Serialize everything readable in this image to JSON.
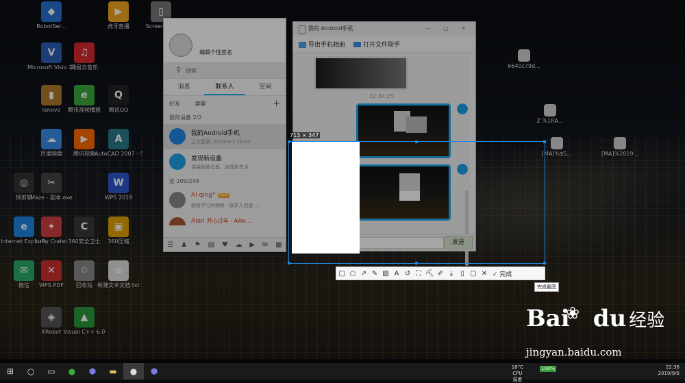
{
  "desktop": {
    "icons": [
      {
        "label": "RobotSer...",
        "glyph": "◆",
        "color": "#2a6fd0"
      },
      {
        "label": "虎牙直播",
        "glyph": "▶",
        "color": "#f5a623"
      },
      {
        "label": "Screenshot",
        "glyph": "▯",
        "color": "#777777"
      },
      {
        "label": "Microsoft Visio 2010",
        "glyph": "V",
        "color": "#2b5fb4"
      },
      {
        "label": "网易云音乐",
        "glyph": "♫",
        "color": "#d7282f"
      },
      {
        "label": "lenovo",
        "glyph": "▮",
        "color": "#b07a2a"
      },
      {
        "label": "腾讯视频播放",
        "glyph": "e",
        "color": "#3caa3c"
      },
      {
        "label": "腾讯QQ",
        "glyph": "Q",
        "color": "#222222"
      },
      {
        "label": "百度网盘",
        "glyph": "☁",
        "color": "#3a8ee6"
      },
      {
        "label": "腾讯视频",
        "glyph": "▶",
        "color": "#ff6a00"
      },
      {
        "label": "AutoCAD 2007 - S...",
        "glyph": "A",
        "color": "#2a7a8a"
      },
      {
        "label": "快剪辑",
        "glyph": "◎",
        "color": "#333333"
      },
      {
        "label": "Maze - 副本.exe",
        "glyph": "✂",
        "color": "#444444"
      },
      {
        "label": "WPS 2019",
        "glyph": "W",
        "color": "#2a58d0"
      },
      {
        "label": "Internet Explorer",
        "glyph": "e",
        "color": "#1e88e5"
      },
      {
        "label": "LuBy Crater",
        "glyph": "✦",
        "color": "#d04040"
      },
      {
        "label": "360安全卫士",
        "glyph": "C",
        "color": "#3a3a3a"
      },
      {
        "label": "360压缩",
        "glyph": "▣",
        "color": "#e0a000"
      },
      {
        "label": "微信",
        "glyph": "✉",
        "color": "#2aae67"
      },
      {
        "label": "WPS PDF",
        "glyph": "✕",
        "color": "#d03030"
      },
      {
        "label": "回收站",
        "glyph": "♲",
        "color": "#888888"
      },
      {
        "label": "新建文本文档.txt",
        "glyph": "≡",
        "color": "#dddddd"
      },
      {
        "label": "KRobot",
        "glyph": "◈",
        "color": "#555555"
      },
      {
        "label": "Visual C++ 6.0",
        "glyph": "▲",
        "color": "#2a9a3a"
      }
    ],
    "right_icons": [
      {
        "label": "6640c79d..."
      },
      {
        "label": "Z %1RA..."
      },
      {
        "label": "[MA]%$S..."
      },
      {
        "label": "[MA]%2019..."
      }
    ]
  },
  "qq": {
    "nickname": "编辑个性签名",
    "search_placeholder": "搜索",
    "tabs": [
      "消息",
      "联系人",
      "空间"
    ],
    "subtabs": [
      "好友",
      "群聊"
    ],
    "group_device": "我的设备 2/2",
    "items": [
      {
        "title": "我的Android手机",
        "sub": "上次登录: 2019-9-7 16:42",
        "color": "#1e88e5"
      },
      {
        "title": "发现新设备",
        "sub": "连接智能设备，发现新生活",
        "color": "#1ea0e6"
      }
    ],
    "group_friends": "这 209/244",
    "friends": [
      {
        "title": "Ai qing°",
        "badge": "SVIP",
        "sub": "勤奋学习大萌新 · 联系人回复 ...",
        "color": "#888888"
      },
      {
        "title": "Alan",
        "badge": "",
        "sub": "开心过年 · AWe...",
        "color": "#aa5533"
      }
    ],
    "bottom_icons": [
      "☰",
      "♟",
      "⚑",
      "▤",
      "♥",
      "☁",
      "▶",
      "✉",
      "▦"
    ]
  },
  "chat": {
    "title": "我的 Android手机",
    "export_label": "导出手机相册",
    "open_label": "打开文件助手",
    "timestamp": "22:34:25",
    "send_label": "发送"
  },
  "capture": {
    "size_label": "713 × 347",
    "tools": [
      "□",
      "○",
      "↗",
      "✎",
      "▨",
      "A",
      "↺",
      "⛶",
      "⛏",
      "✐",
      "⤓",
      "▯",
      "▢",
      "✕"
    ],
    "done_label": "✓ 完成",
    "tooltip": "完成截图"
  },
  "watermark": {
    "baidu": "Bai",
    "du": "du",
    "jingyan": "经验",
    "url": "jingyan.baidu.com"
  },
  "taskbar": {
    "temp": "16°C",
    "cpu": "CPU温度",
    "time": "22:36",
    "date": "2019/9/6",
    "battery": "100%"
  }
}
